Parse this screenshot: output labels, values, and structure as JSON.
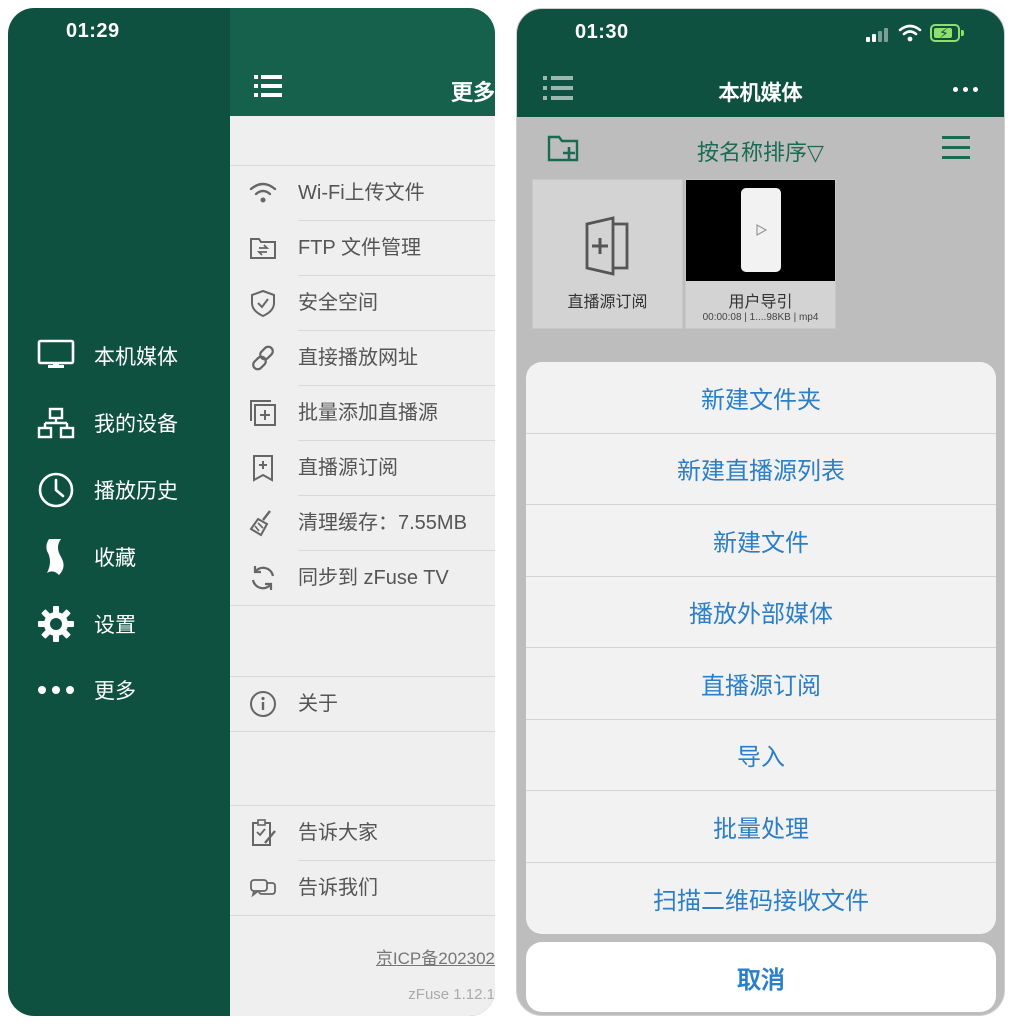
{
  "left_phone": {
    "status": {
      "time": "01:29"
    },
    "drawer": {
      "items": [
        {
          "label": "本机媒体",
          "icon": "monitor-icon"
        },
        {
          "label": "我的设备",
          "icon": "network-icon"
        },
        {
          "label": "播放历史",
          "icon": "clock-icon"
        },
        {
          "label": "收藏",
          "icon": "bookmark-icon"
        },
        {
          "label": "设置",
          "icon": "gear-icon"
        },
        {
          "label": "更多",
          "icon": "more-dots-icon"
        }
      ]
    },
    "panel": {
      "title": "更多",
      "items": [
        {
          "label": "Wi-Fi上传文件",
          "icon": "wifi-icon"
        },
        {
          "label": "FTP 文件管理",
          "icon": "ftp-folder-icon"
        },
        {
          "label": "安全空间",
          "icon": "shield-icon"
        },
        {
          "label": "直接播放网址",
          "icon": "link-icon"
        },
        {
          "label": "批量添加直播源",
          "icon": "add-multiple-icon"
        },
        {
          "label": "直播源订阅",
          "icon": "subscribe-icon"
        },
        {
          "label": "清理缓存：7.55MB",
          "icon": "broom-icon"
        },
        {
          "label": "同步到 zFuse TV",
          "icon": "sync-icon"
        }
      ],
      "about": {
        "label": "关于",
        "icon": "info-icon"
      },
      "share": [
        {
          "label": "告诉大家",
          "icon": "clipboard-edit-icon"
        },
        {
          "label": "告诉我们",
          "icon": "chat-icon"
        }
      ],
      "icp": "京ICP备202302",
      "version": "zFuse 1.12.1"
    }
  },
  "right_phone": {
    "status": {
      "time": "01:30"
    },
    "header": {
      "title": "本机媒体"
    },
    "toolbar": {
      "sort_label": "按名称排序▽"
    },
    "tiles": [
      {
        "label": "直播源订阅"
      },
      {
        "label": "用户导引",
        "meta": "00:00:08 | 1....98KB | mp4"
      }
    ],
    "action_sheet": {
      "items": [
        "新建文件夹",
        "新建直播源列表",
        "新建文件",
        "播放外部媒体",
        "直播源订阅",
        "导入",
        "批量处理",
        "扫描二维码接收文件"
      ],
      "cancel": "取消"
    }
  },
  "colors": {
    "brand_green": "#0f5140",
    "header_green": "#15614c",
    "accent_blue": "#2a7fc8",
    "icon_green": "#1a6b52"
  }
}
